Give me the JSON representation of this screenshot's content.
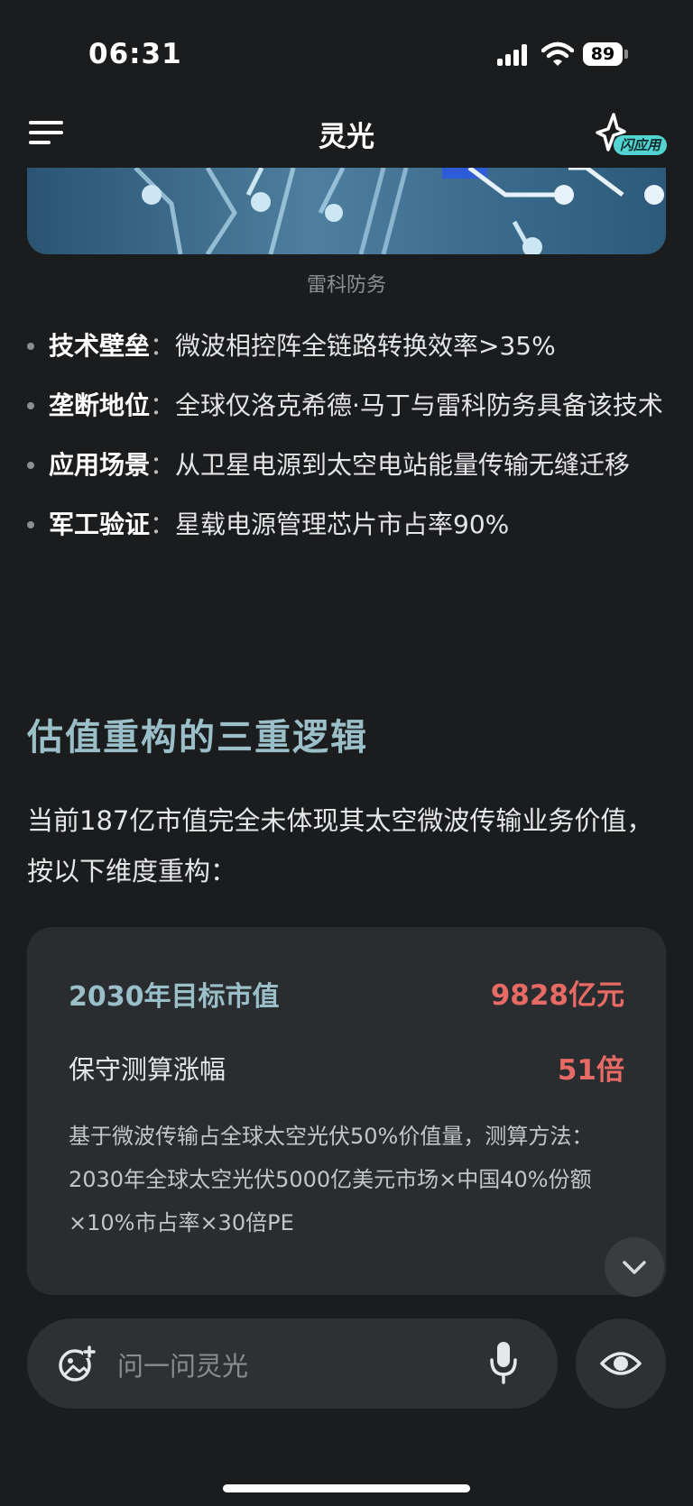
{
  "status_bar": {
    "time": "06:31",
    "battery_level": "89"
  },
  "nav": {
    "title": "灵光",
    "flash_app_badge": "闪应用"
  },
  "banner": {
    "caption": "雷科防务"
  },
  "bullets": [
    {
      "term": "技术壁垒",
      "sep": "：",
      "text": "微波相控阵全链路转换效率>35%"
    },
    {
      "term": "垄断地位",
      "sep": "：",
      "text": "全球仅洛克希德·马丁与雷科防务具备该技术"
    },
    {
      "term": "应用场景",
      "sep": "：",
      "text": "从卫星电源到太空电站能量传输无缝迁移"
    },
    {
      "term": "军工验证",
      "sep": "：",
      "text": "星载电源管理芯片市占率90%"
    }
  ],
  "section": {
    "heading": "估值重构的三重逻辑",
    "paragraph": "当前187亿市值完全未体现其太空微波传输业务价值，按以下维度重构："
  },
  "card": {
    "metric1_label": "2030年目标市值",
    "metric1_value": "9828亿元",
    "metric2_label": "保守测算涨幅",
    "metric2_value": "51倍",
    "note": "基于微波传输占全球太空光伏50%价值量，测算方法：2030年全球太空光伏5000亿美元市场×中国40%份额×10%市占率×30倍PE"
  },
  "input": {
    "placeholder": "问一问灵光"
  },
  "colors": {
    "background": "#1b1c1e",
    "accent_teal": "#9bbfc8",
    "highlight_red": "#e86a64",
    "card_bg": "#2a2d30"
  },
  "icons": [
    "menu-icon",
    "flash-app-icon",
    "signal-icon",
    "wifi-icon",
    "battery-icon",
    "chevron-down-icon",
    "image-add-icon",
    "mic-icon",
    "eye-icon"
  ]
}
